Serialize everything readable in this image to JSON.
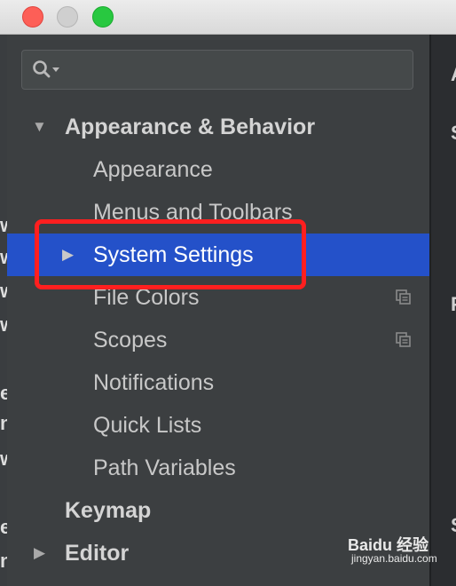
{
  "window": {
    "traffic_lights": [
      "close",
      "minimize",
      "zoom"
    ]
  },
  "search": {
    "placeholder": "",
    "icon": "search-icon"
  },
  "tree": [
    {
      "label": "Appearance & Behavior",
      "bold": true,
      "expanded": true
    },
    {
      "label": "Appearance"
    },
    {
      "label": "Menus and Toolbars"
    },
    {
      "label": "System Settings",
      "selected": true,
      "collapsed": true
    },
    {
      "label": "File Colors",
      "project_icon": true
    },
    {
      "label": "Scopes",
      "project_icon": true
    },
    {
      "label": "Notifications"
    },
    {
      "label": "Quick Lists"
    },
    {
      "label": "Path Variables"
    },
    {
      "label": "Keymap",
      "bold": true
    },
    {
      "label": "Editor",
      "bold": true,
      "collapsed": true
    }
  ],
  "right_panel_fragments": [
    "A",
    "S",
    "P",
    "S"
  ],
  "background_fragments": [
    "w",
    "w",
    "w",
    "w",
    "e",
    "n.",
    "w",
    "e",
    "n."
  ],
  "watermark": {
    "brand": "Baidu 经验",
    "url": "jingyan.baidu.com"
  },
  "colors": {
    "selection": "#2451c9",
    "highlight_border": "#ff1f1f"
  }
}
